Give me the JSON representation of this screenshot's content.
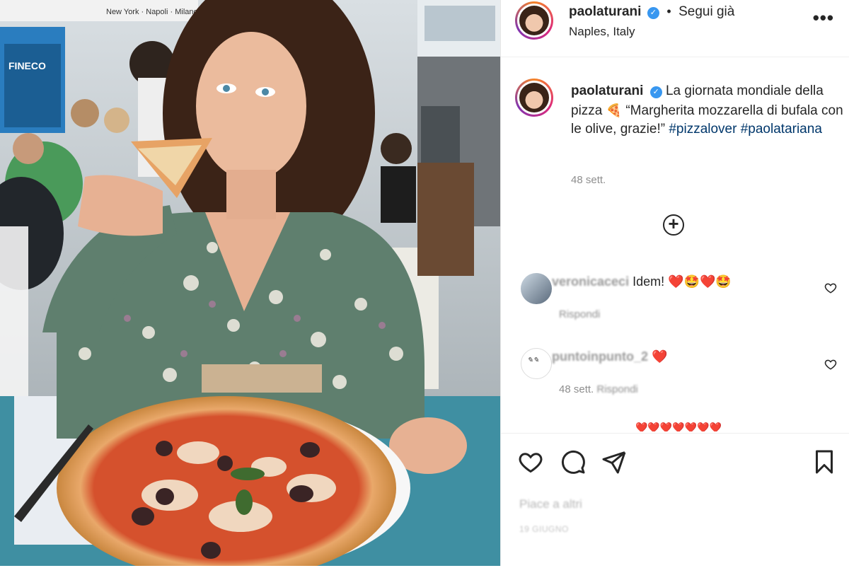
{
  "header": {
    "username": "paolaturani",
    "follow_status": "Segui già",
    "location": "Naples, Italy",
    "more_icon": "more-horizontal-icon"
  },
  "photo": {
    "kind": "woman eating pizza at outdoor table",
    "banner_text": "New York · Napoli · Milano",
    "ad_brand": "FINECO"
  },
  "caption": {
    "username": "paolaturani",
    "text_1": "La giornata mondiale della pizza",
    "pizza_emoji": "🍕",
    "text_2": "“Margherita mozzarella di bufala con le olive, grazie!”",
    "hashtag_1": "#pizzalover",
    "hashtag_2": "#paolatariana",
    "time": "48 sett."
  },
  "load_more_icon": "plus-circle-icon",
  "comments": [
    {
      "username": "veronicaceci",
      "text": "Idem!",
      "emojis": "❤️🤩❤️🤩",
      "meta_action": "Rispondi"
    },
    {
      "username": "puntoinpunto_2",
      "text": "",
      "emojis": "❤️",
      "meta_time": "48 sett.",
      "meta_action": "Rispondi"
    },
    {
      "username": "",
      "emojis": "❤️❤️❤️❤️❤️❤️❤️"
    }
  ],
  "actions": {
    "like_icon": "heart-icon",
    "comment_icon": "comment-icon",
    "share_icon": "send-icon",
    "save_icon": "bookmark-icon",
    "likes_text": "Piace a altri",
    "date_text": "19 GIUGNO"
  },
  "colors": {
    "accent_link": "#00376b",
    "verified_blue": "#3897f0",
    "muted": "#8e8e8e",
    "heart_red": "#ed4956"
  }
}
